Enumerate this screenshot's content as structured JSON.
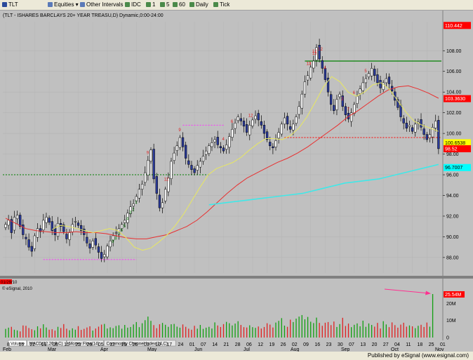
{
  "toolbar": {
    "items": [
      {
        "label": "TLT",
        "icon": "symbol-icon"
      },
      {
        "label": "Equities",
        "icon": "dropdown-icon"
      },
      {
        "label": "Other Intervals",
        "icon": "dropdown-icon"
      },
      {
        "label": "IDC",
        "icon": "interval-icon"
      },
      {
        "label": "1",
        "icon": "interval-icon"
      },
      {
        "label": "5",
        "icon": "interval-icon"
      },
      {
        "label": "60",
        "icon": "interval-icon"
      },
      {
        "label": "Daily",
        "icon": "interval-icon"
      },
      {
        "label": "Tick",
        "icon": "interval-icon"
      }
    ]
  },
  "chart_title": "(TLT - ISHARES BARCLAYS 20+ YEAR TREASU,D) Dynamic,0:00-24:00",
  "lower_panel_date": "01/29/10",
  "lower_panel_source": "© eSignal, 2010",
  "tabs": [
    "Volume",
    "MACD(12,26,9,C)",
    "Money Flow(14)",
    "Commodity Channel Index(14,C)"
  ],
  "status": {
    "publisher": "Published by eSignal (www.esignal.com)"
  },
  "colors": {
    "background": "#c0c0c0",
    "price_label": "#ff0000",
    "ma_red": "#e83030",
    "ma_yellow": "#e8e860",
    "ma_cyan": "#40e8e8",
    "resistance_green": "#008000",
    "support_red": "#ff0000",
    "marker_magenta": "#ff30ff",
    "volume_arrow": "#ff3090"
  },
  "chart_data": [
    {
      "type": "candlestick",
      "title": "(TLT - ISHARES BARCLAYS 20+ YEAR TREASU,D) Dynamic,0:00-24:00",
      "ylim": [
        86.5,
        110.8
      ],
      "yticks": [
        88.0,
        90.0,
        92.0,
        94.0,
        96.0,
        98.0,
        100.0,
        102.0,
        104.0,
        106.0,
        108.0
      ],
      "x_month_labels": [
        "Feb",
        "Mar",
        "Apr",
        "May",
        "Jun",
        "Jul",
        "Aug",
        "Sep",
        "Oct",
        "Nov"
      ],
      "x_day_labels": [
        "8",
        "16",
        "22",
        "01",
        "08",
        "15",
        "22",
        "29",
        "05",
        "12",
        "19",
        "26",
        "03",
        "10",
        "17",
        "24",
        "01",
        "07",
        "14",
        "21",
        "28",
        "06",
        "12",
        "19",
        "26",
        "02",
        "09",
        "16",
        "23",
        "30",
        "07",
        "13",
        "20",
        "27",
        "04",
        "11",
        "18",
        "25",
        "01"
      ],
      "price_labels": [
        {
          "text": "110.442",
          "value": 110.442,
          "bg": "#ff0000"
        },
        {
          "text": "103.3630",
          "value": 103.363,
          "bg": "#ff0000"
        },
        {
          "text": "100.6538",
          "value": 99.1,
          "bg": "#ffff00"
        },
        {
          "text": "98.52",
          "value": 98.52,
          "bg": "#ff0000"
        },
        {
          "text": "96.7007",
          "value": 96.7,
          "bg": "#00ffff"
        }
      ],
      "horizontal_lines": [
        {
          "name": "resistance",
          "y": 107.0,
          "x_start": "Aug 30",
          "x_end": "Nov 01",
          "color": "#008000"
        },
        {
          "name": "support",
          "y": 99.6,
          "x_start": "Aug 02",
          "x_end": "Nov 01",
          "color": "#ff0000"
        },
        {
          "name": "green-dashed",
          "y": 96.0,
          "x_start": "Feb 01",
          "x_end": "Jul 02",
          "color": "#008000"
        },
        {
          "name": "magenta-low",
          "y": 87.8,
          "x_start": "Feb 22",
          "x_end": "Apr 05",
          "color": "#ff30ff"
        },
        {
          "name": "magenta-mid",
          "y": 100.8,
          "x_start": "Jun 03",
          "x_end": "Jun 24",
          "color": "#ff30ff"
        }
      ],
      "moving_averages": [
        {
          "name": "red-ma",
          "color": "#e83030"
        },
        {
          "name": "yellow-ma",
          "color": "#e8e860"
        },
        {
          "name": "cyan-ma",
          "color": "#40e8e8"
        }
      ],
      "candles_close": [
        91.2,
        91.6,
        90.4,
        91.9,
        92.1,
        91.0,
        90.2,
        89.8,
        89.0,
        88.6,
        90.1,
        90.8,
        90.5,
        91.6,
        91.9,
        91.4,
        90.6,
        90.2,
        91.3,
        91.0,
        90.5,
        89.8,
        90.4,
        91.2,
        91.5,
        91.1,
        90.6,
        90.2,
        89.4,
        88.9,
        89.6,
        89.2,
        88.5,
        87.9,
        88.3,
        89.1,
        89.6,
        90.1,
        90.4,
        90.8,
        91.2,
        91.6,
        92.3,
        92.9,
        93.2,
        93.9,
        94.6,
        95.1,
        96.2,
        97.4,
        98.4,
        95.6,
        94.2,
        92.8,
        93.3,
        94.6,
        95.7,
        97.3,
        98.1,
        98.8,
        99.6,
        98.7,
        97.6,
        97.0,
        96.5,
        96.2,
        96.9,
        97.3,
        97.8,
        98.3,
        98.8,
        99.1,
        99.4,
        98.9,
        98.6,
        98.3,
        98.9,
        99.7,
        100.4,
        101.0,
        101.6,
        101.2,
        100.7,
        100.1,
        100.8,
        101.3,
        101.7,
        101.3,
        100.8,
        100.0,
        99.4,
        98.8,
        98.6,
        99.3,
        100.1,
        100.9,
        101.5,
        100.9,
        100.4,
        100.9,
        101.6,
        102.6,
        103.8,
        105.0,
        105.6,
        106.4,
        107.0,
        108.3,
        107.2,
        106.3,
        105.2,
        104.0,
        102.8,
        102.2,
        103.3,
        103.8,
        102.6,
        101.8,
        101.4,
        102.0,
        102.8,
        103.6,
        104.3,
        104.9,
        105.3,
        105.8,
        106.3,
        105.6,
        104.9,
        104.4,
        104.9,
        105.3,
        104.8,
        104.1,
        103.2,
        102.5,
        101.6,
        101.0,
        100.5,
        100.8,
        100.2,
        100.9,
        101.1,
        100.6,
        99.9,
        99.4,
        99.9,
        100.6,
        101.2,
        98.52
      ],
      "numbered_markers_red": [
        "9",
        "12",
        "4",
        "6",
        "12",
        "13",
        "13",
        "12",
        "4",
        "2",
        "7",
        "6",
        "5",
        "12",
        "13",
        "9"
      ],
      "numbered_markers_green": [
        "9",
        "8",
        "7",
        "6",
        "5",
        "4",
        "3",
        "2",
        "1"
      ],
      "ma_values": {
        "red": [
          91.8,
          91.3,
          90.8,
          90.6,
          90.5,
          90.4,
          90.4,
          90.5,
          90.4,
          90.4,
          90.3,
          90.1,
          89.9,
          89.8,
          89.8,
          90.0,
          90.2,
          90.6,
          91.0,
          91.6,
          92.4,
          93.3,
          94.2,
          95.0,
          95.7,
          96.2,
          96.7,
          97.2,
          97.6,
          98.1,
          98.7,
          99.4,
          100.1,
          100.8,
          101.6,
          102.2,
          102.9,
          103.6,
          104.2,
          104.5,
          104.6,
          104.3,
          103.9,
          103.4
        ],
        "yellow": [
          90.7,
          91.1,
          91.0,
          90.8,
          90.6,
          90.4,
          90.6,
          90.8,
          90.6,
          89.9,
          89.0,
          88.7,
          88.9,
          89.5,
          90.2,
          91.1,
          92.2,
          93.5,
          94.8,
          96.0,
          96.6,
          96.9,
          97.2,
          97.7,
          98.4,
          99.0,
          99.5,
          99.5,
          99.4,
          99.8,
          100.5,
          101.6,
          103.0,
          104.5,
          105.5,
          105.0,
          104.0,
          103.6,
          104.0,
          104.7,
          104.9,
          104.3,
          103.2,
          102.1,
          101.2,
          100.8,
          100.5,
          100.2
        ],
        "cyan": [
          93.1,
          93.2,
          93.3,
          93.4,
          93.5,
          93.6,
          93.7,
          93.8,
          93.9,
          94.0,
          94.1,
          94.2,
          94.4,
          94.6,
          94.8,
          95.0,
          95.2,
          95.3,
          95.4,
          95.5,
          95.6,
          95.8,
          96.0,
          96.2,
          96.4,
          96.6,
          96.8,
          97.0
        ]
      }
    },
    {
      "type": "bar",
      "title": "Volume",
      "ylim": [
        0,
        25.54
      ],
      "yticks": [
        "0",
        "10M",
        "20M"
      ],
      "price_label": {
        "text": "25.54M",
        "bg": "#ff0000"
      },
      "values": [
        5.1,
        5.8,
        6.3,
        4.6,
        4.2,
        3.6,
        7.1,
        6.9,
        5.6,
        4.9,
        4.3,
        6.6,
        5.4,
        7.8,
        5.9,
        4.6,
        4.9,
        4.1,
        6.3,
        5.6,
        7.9,
        5.2,
        4.3,
        5.4,
        4.6,
        6.7,
        4.5,
        5.1,
        5.9,
        6.6,
        4.1,
        5.3,
        6.4,
        7.6,
        8.0,
        5.3,
        6.0,
        5.5,
        6.8,
        7.2,
        5.2,
        7.4,
        5.8,
        6.2,
        7.7,
        9.1,
        6.1,
        8.4,
        10.2,
        12.3,
        9.8,
        7.3,
        5.5,
        7.8,
        8.6,
        7.5,
        6.3,
        7.8,
        8.0,
        6.4,
        5.8,
        7.7,
        6.3,
        5.2,
        4.6,
        6.9,
        5.2,
        7.4,
        5.1,
        5.8,
        6.3,
        5.3,
        8.9,
        7.1,
        6.2,
        7.9,
        9.2,
        8.4,
        7.1,
        8.2,
        9.6,
        7.4,
        6.1,
        5.9,
        7.2,
        6.1,
        5.7,
        6.5,
        5.3,
        6.2,
        8.4,
        7.6,
        5.9,
        8.8,
        9.8,
        11.4,
        7.0,
        6.3,
        10.5,
        9.1,
        11.1,
        12.3,
        13.2,
        10.7,
        12.1,
        9.3,
        8.5,
        11.7,
        8.6,
        6.9,
        8.7,
        9.1,
        7.3,
        9.4,
        6.2,
        7.9,
        11.6,
        6.8,
        8.2,
        6.1,
        7.5,
        8.3,
        6.6,
        9.9,
        6.3,
        8.3,
        7.4,
        6.4,
        8.6,
        5.3,
        9.6,
        7.7,
        6.1,
        8.9,
        7.3,
        5.8,
        7.6,
        8.7,
        6.4,
        7.1,
        6.6,
        5.5,
        6.9,
        7.5,
        6.2,
        8.8,
        6.4,
        25.54
      ],
      "annotation": "magenta arrow pointing to spike"
    }
  ]
}
